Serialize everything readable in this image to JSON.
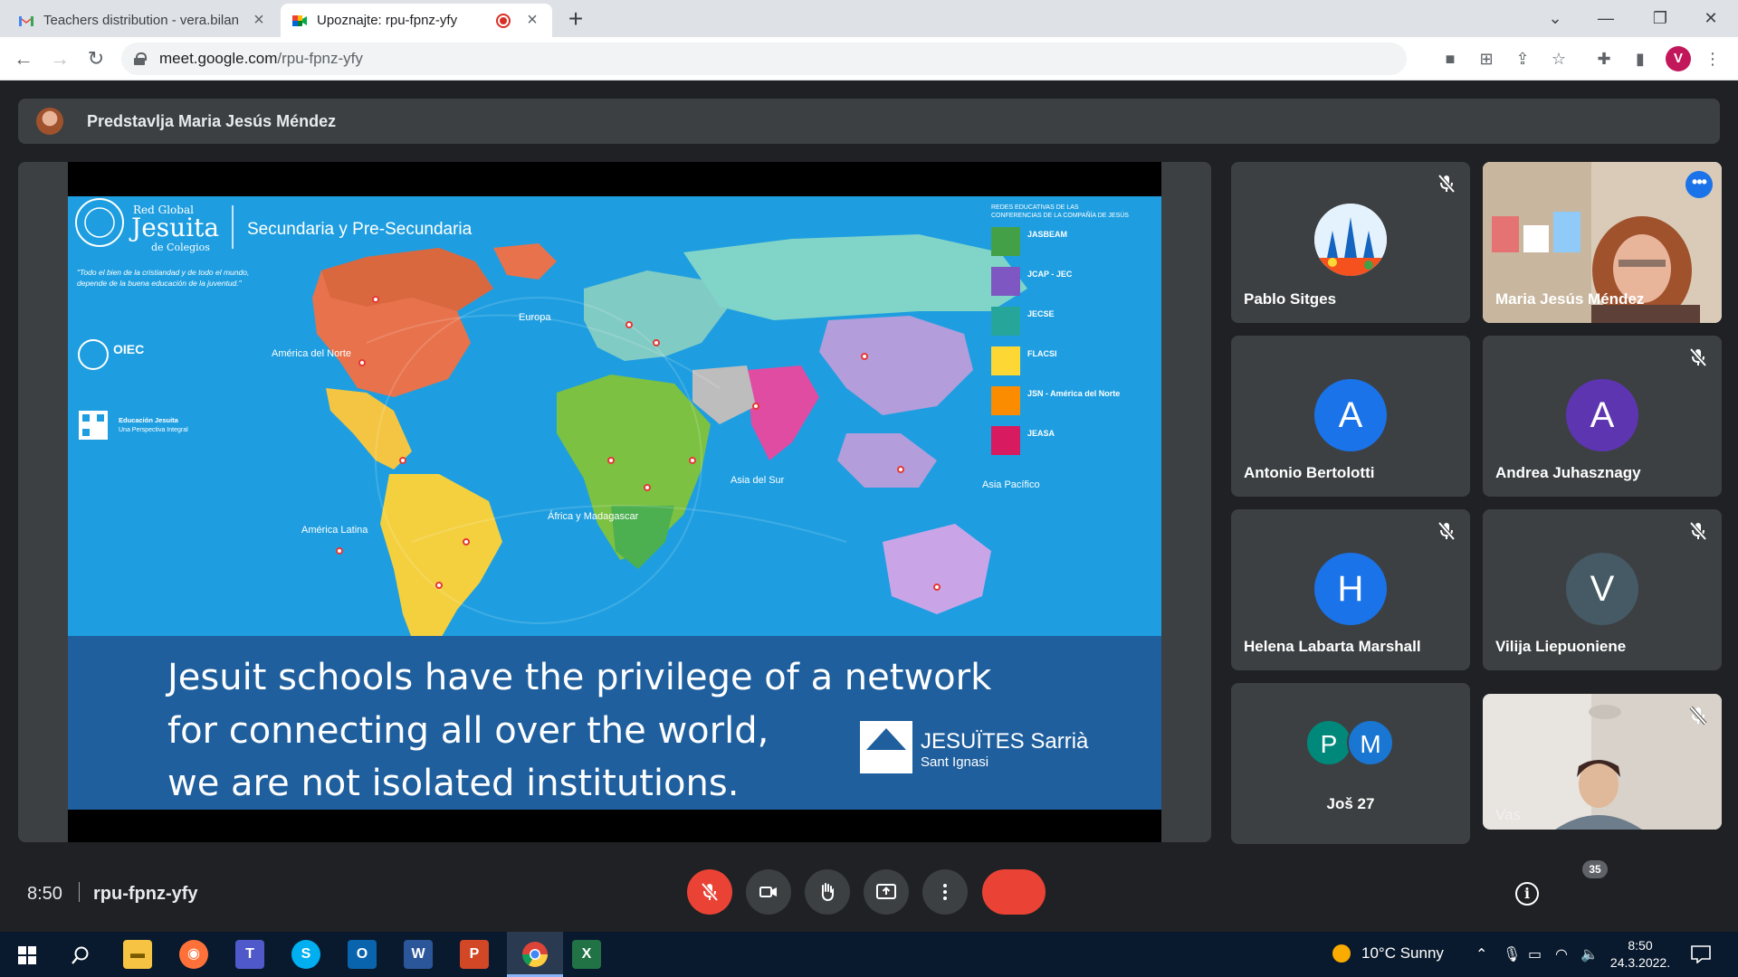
{
  "browser": {
    "tabs": [
      {
        "title": "Teachers distribution - vera.bilan",
        "icon": "gmail-icon",
        "active": false
      },
      {
        "title": "Upoznajte: rpu-fpnz-yfy",
        "icon": "google-meet-icon",
        "active": true
      }
    ],
    "url_host": "meet.google.com",
    "url_path": "/rpu-fpnz-yfy",
    "profile_initial": "V"
  },
  "meet": {
    "presenting_label": "Predstavlja Maria Jesús Méndez",
    "time": "8:50",
    "meeting_code": "rpu-fpnz-yfy",
    "participant_count": "35",
    "participants": [
      {
        "name": "Pablo Sitges",
        "avatar": "",
        "muted": true
      },
      {
        "name": "Maria Jesús Méndez",
        "video": true,
        "muted": false,
        "selected": true
      },
      {
        "name": "Antonio Bertolotti",
        "avatar": "A",
        "color": "#1a73e8",
        "muted": false
      },
      {
        "name": "Andrea Juhasznagy",
        "avatar": "A",
        "color": "#5e35b1",
        "muted": true
      },
      {
        "name": "Helena Labarta Marshall",
        "avatar": "H",
        "color": "#1a73e8",
        "muted": true
      },
      {
        "name": "Vilija Liepuoniene",
        "avatar": "V",
        "color": "#455a64",
        "muted": true
      },
      {
        "name": "Još 27",
        "avatars": [
          "P",
          "M"
        ],
        "colors": [
          "#00897b",
          "#1976d2"
        ]
      },
      {
        "name": "Vas",
        "video": true,
        "muted": true
      }
    ]
  },
  "slide": {
    "logo_line1": "Red Global",
    "logo_line2": "Jesuita",
    "logo_line3": "de Colegios",
    "header_title": "Secundaria y Pre-Secundaria",
    "quote_line1": "\"Todo el bien de la cristiandad y de todo el mundo,",
    "quote_line2": "depende de la buena educación de la juventud.\"",
    "oiec": "OIEC",
    "edu_label1": "Educación Jesuita",
    "edu_label2": "Una Perspectiva Integral",
    "legend_title1": "REDES EDUCATIVAS DE LAS",
    "legend_title2": "CONFERENCIAS DE LA COMPAÑÍA DE JESÚS",
    "networks": [
      "JASBEAM",
      "JCAP - JEC",
      "JECSE",
      "FLACSI",
      "JSN - América del Norte",
      "JEASA"
    ],
    "network_colors": [
      "#43a047",
      "#7e57c2",
      "#26a69a",
      "#fdd835",
      "#fb8c00",
      "#d81b60"
    ],
    "regions": [
      "América del Norte",
      "Europa",
      "Asia del Sur",
      "Asia Pacífico",
      "África y Madagascar",
      "América Latina"
    ],
    "caption_line1": "Jesuit schools have the privilege of a network",
    "caption_line2": "for connecting all over the world,",
    "caption_line3": "we are not isolated institutions.",
    "brand_line1": "JESUÏTES Sarrià",
    "brand_line2": "Sant Ignasi"
  },
  "taskbar": {
    "weather": "10°C  Sunny",
    "time": "8:50",
    "date": "24.3.2022."
  }
}
